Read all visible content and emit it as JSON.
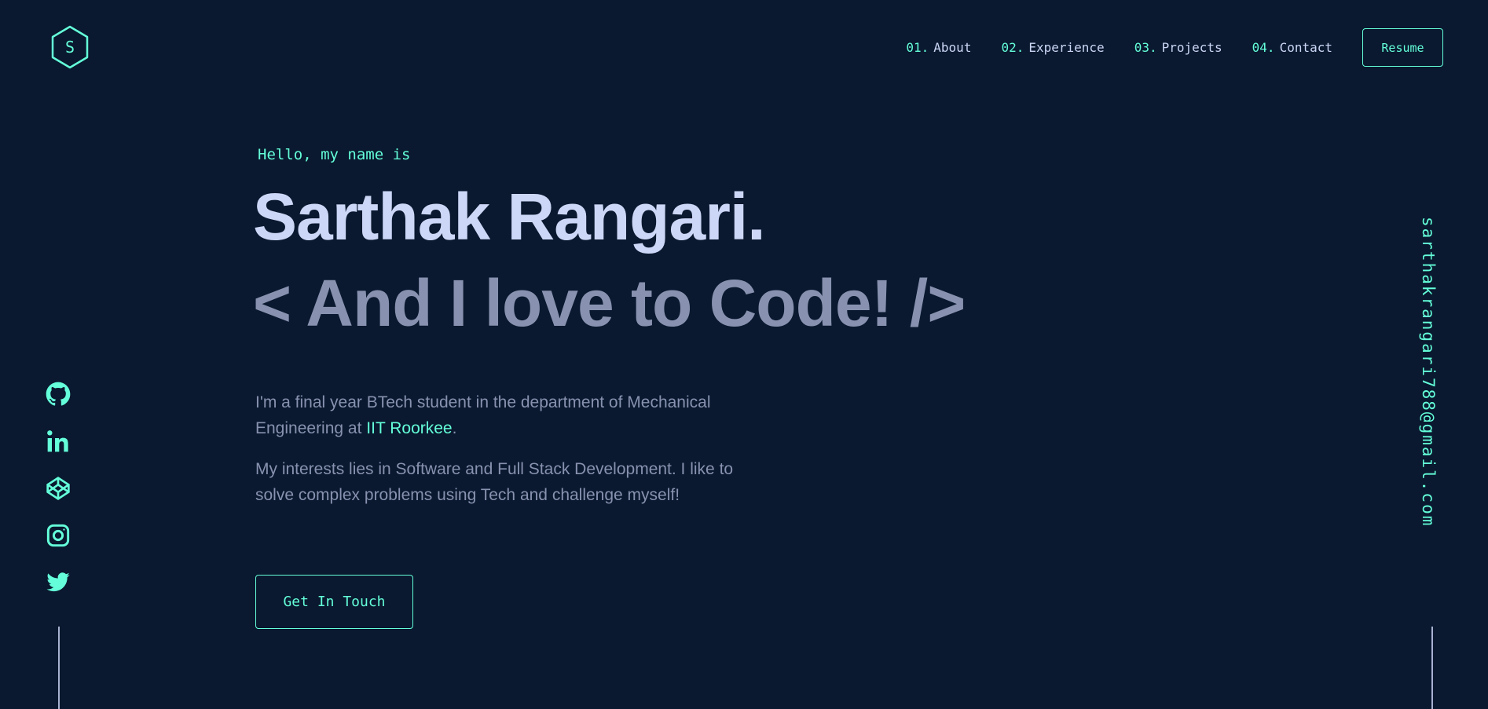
{
  "logo": {
    "letter": "S"
  },
  "nav": {
    "items": [
      {
        "num": "01.",
        "label": "About"
      },
      {
        "num": "02.",
        "label": "Experience"
      },
      {
        "num": "03.",
        "label": "Projects"
      },
      {
        "num": "04.",
        "label": "Contact"
      }
    ],
    "resume_label": "Resume"
  },
  "hero": {
    "greeting": "Hello, my name is",
    "name": "Sarthak Rangari.",
    "tagline": "< And I love to Code! />",
    "bio1_prefix": "I'm a final year BTech student in the department of Mechanical Engineering at ",
    "bio1_link": "IIT Roorkee",
    "bio1_suffix": ".",
    "bio2": "My interests lies in Software and Full Stack Development. I like to solve complex problems using Tech and challenge myself!",
    "cta_label": "Get In Touch"
  },
  "social": {
    "icons": [
      "github-icon",
      "linkedin-icon",
      "codepen-icon",
      "instagram-icon",
      "twitter-icon"
    ]
  },
  "email": "sarthakrangari788@gmail.com",
  "colors": {
    "background": "#0a192f",
    "accent": "#64ffda",
    "heading": "#ccd6f6",
    "text": "#8892b0"
  }
}
